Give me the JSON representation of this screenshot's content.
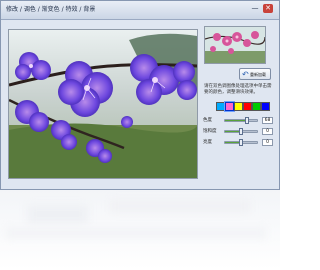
{
  "window": {
    "title": "修改 / 调色 / 渐变色 / 特效 / 背景",
    "minimize_glyph": "—",
    "close_glyph": "✕"
  },
  "preview": {
    "restore_label": "重新加载",
    "restore_icon": "undo-arrow-icon",
    "instruction": "请在双色调图像处理选项中单击需要的颜色，调整滑块效果。"
  },
  "palette": {
    "colors": [
      "#00aaff",
      "#ff66cc",
      "#ffff00",
      "#ff0000",
      "#00cc00",
      "#0000ff"
    ],
    "selected_index": 1
  },
  "adjustments": [
    {
      "label": "色度",
      "value": "68",
      "fraction": 0.68
    },
    {
      "label": "饱和度",
      "value": "0",
      "fraction": 0.5
    },
    {
      "label": "亮度",
      "value": "0",
      "fraction": 0.5
    }
  ],
  "colors": {
    "window_bg": "#dfe6f1",
    "slider_fill": "#58a23a",
    "flower": "#5b3bd6"
  }
}
